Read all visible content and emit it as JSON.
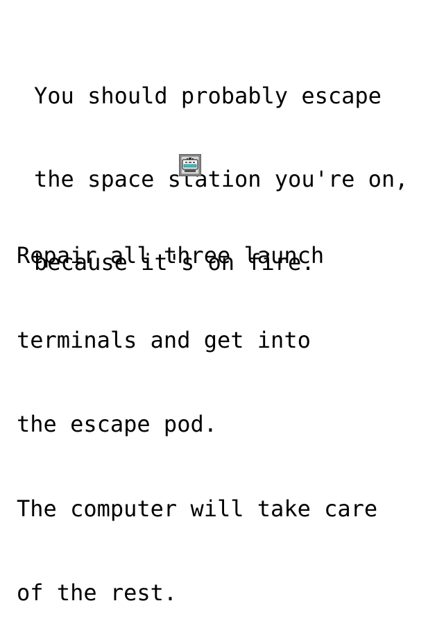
{
  "intro": {
    "lines": [
      "You should probably escape",
      "the space station you're on,",
      "because it's on fire."
    ]
  },
  "icon": {
    "name": "escape-pod-icon"
  },
  "instructions": {
    "lines": [
      "Repair all three launch",
      "terminals and get into",
      "the escape pod.",
      "The computer will take care",
      "of the rest."
    ]
  }
}
